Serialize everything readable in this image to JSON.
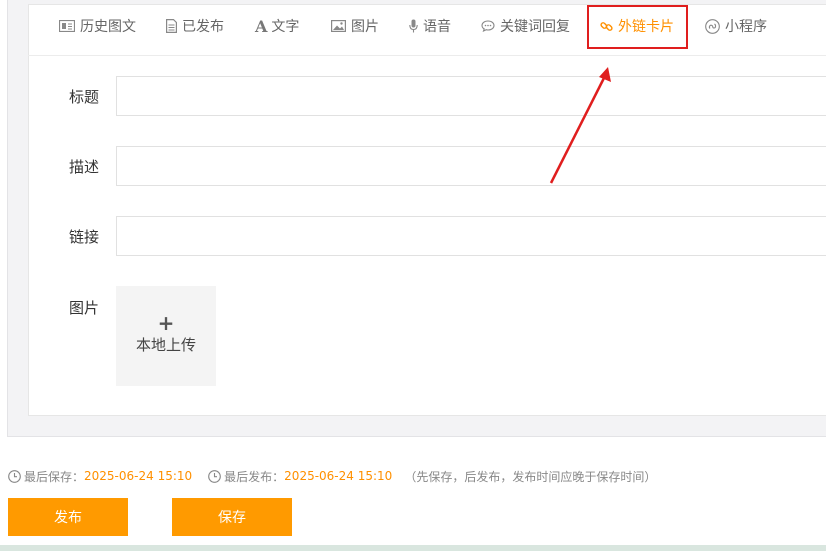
{
  "tabs": [
    {
      "label": "历史图文",
      "icon": "history-icon"
    },
    {
      "label": "已发布",
      "icon": "document-icon"
    },
    {
      "label": "文字",
      "icon": "text-icon"
    },
    {
      "label": "图片",
      "icon": "image-icon"
    },
    {
      "label": "语音",
      "icon": "microphone-icon"
    },
    {
      "label": "关键词回复",
      "icon": "chat-icon"
    },
    {
      "label": "外链卡片",
      "icon": "link-icon",
      "active": true
    },
    {
      "label": "小程序",
      "icon": "mini-program-icon"
    }
  ],
  "form": {
    "title_label": "标题",
    "title_value": "",
    "description_label": "描述",
    "description_value": "",
    "link_label": "链接",
    "link_value": "",
    "image_label": "图片",
    "upload_plus": "+",
    "upload_text": "本地上传"
  },
  "meta": {
    "last_saved_label": "最后保存：",
    "last_saved_time": "2025-06-24 15:10",
    "last_published_label": "最后发布：",
    "last_published_time": "2025-06-24 15:10",
    "note": "（先保存，后发布，发布时间应晚于保存时间）"
  },
  "actions": {
    "publish_label": "发布",
    "save_label": "保存"
  },
  "colors": {
    "accent": "#ff9a00",
    "highlight": "#e01e1e"
  }
}
